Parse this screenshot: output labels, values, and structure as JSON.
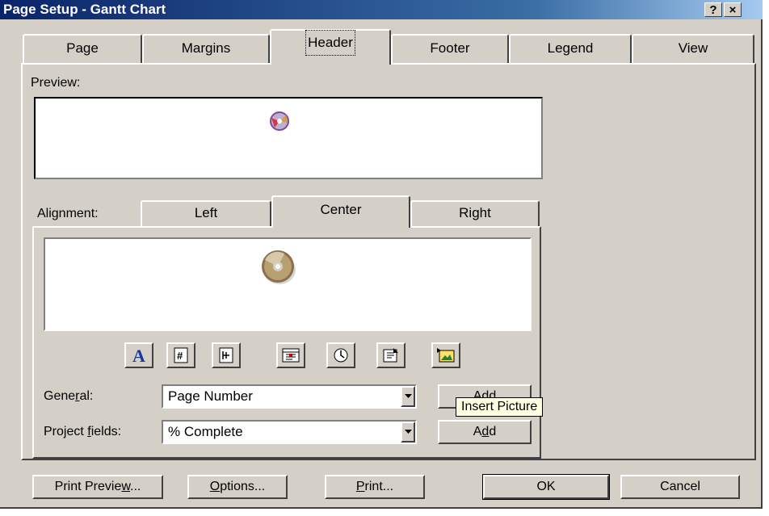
{
  "window": {
    "title": "Page Setup - Gantt Chart",
    "help_btn": "?",
    "close_btn": "×"
  },
  "tabs": [
    "Page",
    "Margins",
    "Header",
    "Footer",
    "Legend",
    "View"
  ],
  "active_tab": "Header",
  "preview_label": "Preview:",
  "alignment": {
    "label": "Alignment:",
    "tabs": [
      "Left",
      "Center",
      "Right"
    ],
    "active": "Center"
  },
  "toolbar_icons": [
    "format-text-font-icon",
    "insert-page-number-icon",
    "insert-total-pages-icon",
    "insert-current-date-icon",
    "insert-current-time-icon",
    "insert-file-name-icon",
    "insert-picture-icon"
  ],
  "general": {
    "label_pre": "Gene",
    "label_ul": "r",
    "label_post": "al:",
    "value": "Page Number",
    "add_pre": "A",
    "add_ul": "d",
    "add_post": "d"
  },
  "project_fields": {
    "label_pre": "Project ",
    "label_ul": "f",
    "label_post": "ields:",
    "value": "% Complete",
    "add_pre": "A",
    "add_ul": "d",
    "add_post": "d"
  },
  "tooltip": "Insert Picture",
  "buttons": {
    "print_preview": {
      "pre": "Print Previe",
      "ul": "w",
      "post": "..."
    },
    "options": {
      "pre": "",
      "ul": "O",
      "post": "ptions..."
    },
    "print": {
      "pre": "",
      "ul": "P",
      "post": "rint..."
    },
    "ok": "OK",
    "cancel": "Cancel"
  },
  "colors": {
    "face": "#d4d0c8",
    "title_blue": "#0a246a",
    "tooltip_bg": "#ffffe1"
  }
}
